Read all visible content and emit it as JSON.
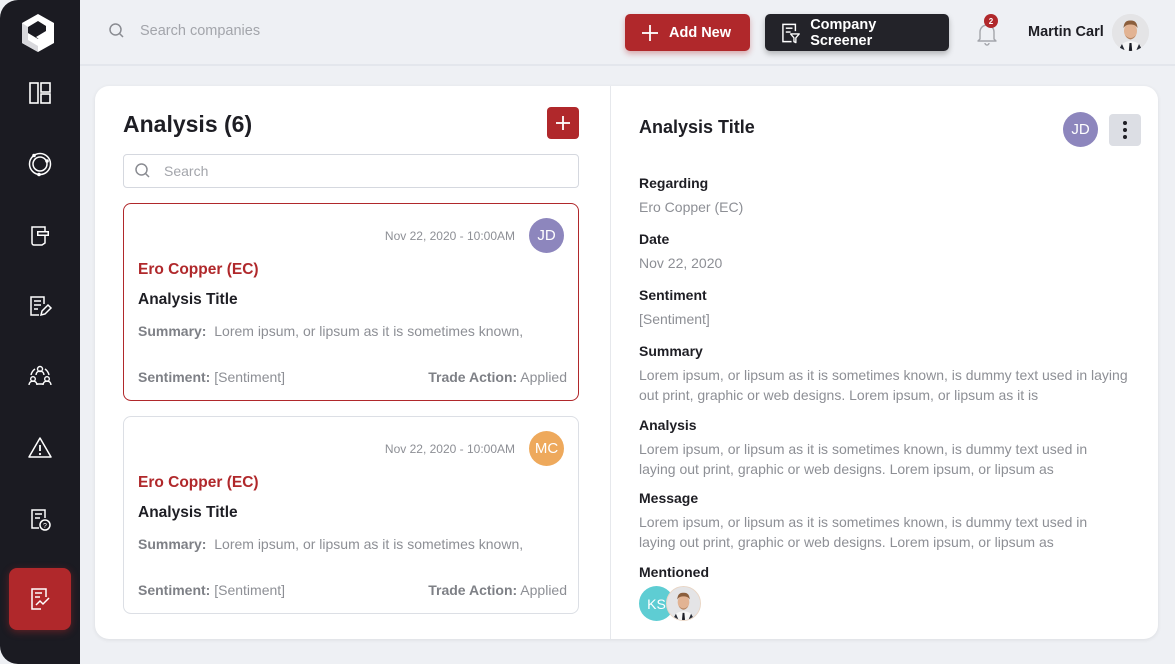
{
  "sidebar": {
    "logo": "brand-logo",
    "items": [
      {
        "icon": "dashboard-icon",
        "active": false
      },
      {
        "icon": "orbit-icon",
        "active": false
      },
      {
        "icon": "news-icon",
        "active": false
      },
      {
        "icon": "notes-edit-icon",
        "active": false
      },
      {
        "icon": "network-people-icon",
        "active": false
      },
      {
        "icon": "warning-icon",
        "active": false
      },
      {
        "icon": "document-question-icon",
        "active": false
      },
      {
        "icon": "analysis-document-icon",
        "active": true
      }
    ]
  },
  "topbar": {
    "search_placeholder": "Search companies",
    "add_new_label": "Add New",
    "screener_label": "Company Screener",
    "notification_count": "2",
    "user_name": "Martin Carl"
  },
  "list": {
    "title": "Analysis (6)",
    "search_placeholder": "Search",
    "cards": [
      {
        "timestamp": "Nov 22, 2020 - 10:00AM",
        "initials": "JD",
        "avatar_color": "#8d86bd",
        "company": "Ero Copper (EC)",
        "title": "Analysis Title",
        "summary_label": "Summary:",
        "summary": "Lorem ipsum, or lipsum as it is sometimes known,",
        "sentiment_label": "Sentiment:",
        "sentiment": "[Sentiment]",
        "trade_label": "Trade Action:",
        "trade": "Applied",
        "selected": true
      },
      {
        "timestamp": "Nov 22, 2020 - 10:00AM",
        "initials": "MC",
        "avatar_color": "#eea95c",
        "company": "Ero Copper (EC)",
        "title": "Analysis Title",
        "summary_label": "Summary:",
        "summary": "Lorem ipsum, or lipsum as it is sometimes known,",
        "sentiment_label": "Sentiment:",
        "sentiment": "[Sentiment]",
        "trade_label": "Trade Action:",
        "trade": "Applied",
        "selected": false
      }
    ]
  },
  "detail": {
    "title": "Analysis Title",
    "initials": "JD",
    "fields": {
      "regarding": {
        "label": "Regarding",
        "value": "Ero Copper (EC)"
      },
      "date": {
        "label": "Date",
        "value": "Nov 22, 2020"
      },
      "sentiment": {
        "label": "Sentiment",
        "value": "[Sentiment]"
      },
      "summary": {
        "label": "Summary",
        "value": "Lorem ipsum, or lipsum as it is sometimes known, is dummy text used in laying out print, graphic or web designs. Lorem ipsum, or lipsum as it is"
      },
      "analysis": {
        "label": "Analysis",
        "value": "Lorem ipsum, or lipsum as it is sometimes known, is dummy text used in laying out print, graphic or web designs. Lorem ipsum, or lipsum as"
      },
      "message": {
        "label": "Message",
        "value": "Lorem ipsum, or lipsum as it is sometimes known, is dummy text used in laying out print, graphic or web designs. Lorem ipsum, or lipsum as"
      }
    },
    "mentioned_label": "Mentioned",
    "mentioned": [
      "KS",
      "photo"
    ]
  },
  "colors": {
    "accent": "#b0282b",
    "sidebar_bg": "#1b1b22",
    "page_bg": "#eef0f4"
  }
}
